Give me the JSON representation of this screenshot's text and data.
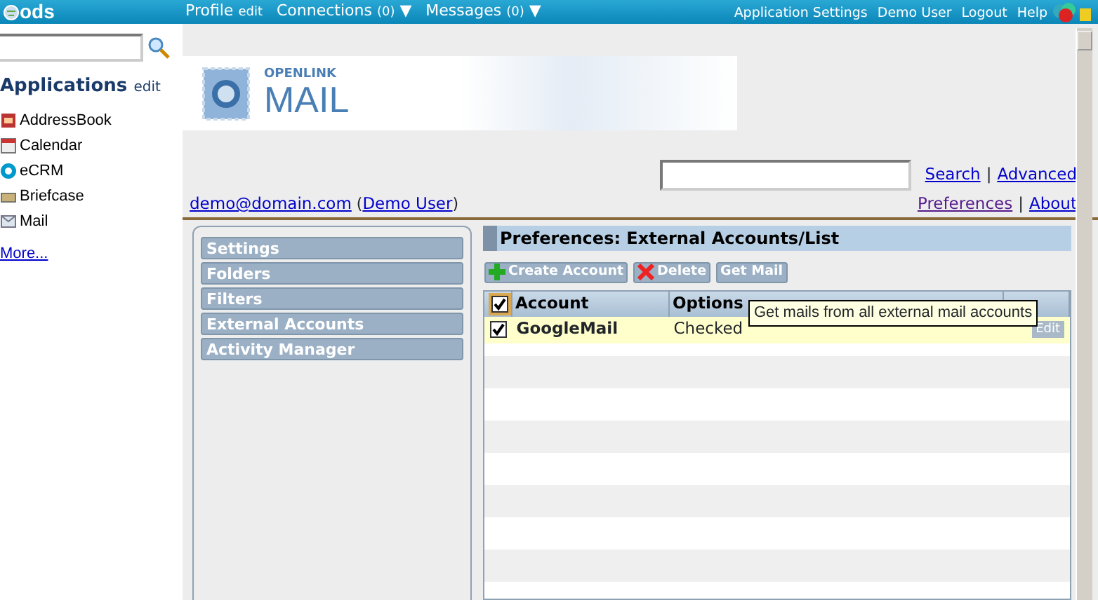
{
  "top_bar": {
    "logo": "ods",
    "menus": [
      {
        "label": "Profile",
        "extra": "edit"
      },
      {
        "label": "Connections",
        "extra": "(0)",
        "caret": "▼"
      },
      {
        "label": "Messages",
        "extra": "(0)",
        "caret": "▼"
      }
    ],
    "links": [
      "Application Settings",
      "Demo User",
      "Logout",
      "Help"
    ]
  },
  "sidebar": {
    "title": "Applications",
    "edit": "edit",
    "apps": [
      {
        "label": "AddressBook",
        "kind": "addressbook"
      },
      {
        "label": "Calendar",
        "kind": "calendar"
      },
      {
        "label": "eCRM",
        "kind": "ecrm"
      },
      {
        "label": "Briefcase",
        "kind": "briefcase"
      },
      {
        "label": "Mail",
        "kind": "mail"
      }
    ],
    "more": "More..."
  },
  "banner": {
    "brand_small": "OPENLINK",
    "brand_large": "MAIL"
  },
  "search_links": [
    {
      "label": "Search",
      "visited": false
    },
    {
      "label": "|"
    },
    {
      "label": "Advanced",
      "visited": false
    }
  ],
  "user_line": {
    "email": "demo@domain.com",
    "open": "(",
    "name": "Demo User",
    "close": ")"
  },
  "pref_links": [
    {
      "label": "Preferences",
      "visited": true
    },
    {
      "label": "|"
    },
    {
      "label": "About",
      "visited": false
    }
  ],
  "nav": [
    "Settings",
    "Folders",
    "Filters",
    "External Accounts",
    "Activity Manager"
  ],
  "panel": {
    "title": "Preferences: External Accounts/List",
    "toolbar": [
      {
        "label": "Create Account",
        "kind": "create"
      },
      {
        "label": "Delete",
        "kind": "delete"
      },
      {
        "label": "Get Mail",
        "kind": "plain"
      }
    ],
    "table": {
      "select_all": {
        "checked": true
      },
      "columns": [
        "Account",
        "Options"
      ],
      "rows": [
        {
          "checked": true,
          "account": "GoogleMail",
          "options": "Checked",
          "action": "Edit"
        }
      ]
    },
    "tooltip": "Get mails from all external mail accounts"
  }
}
